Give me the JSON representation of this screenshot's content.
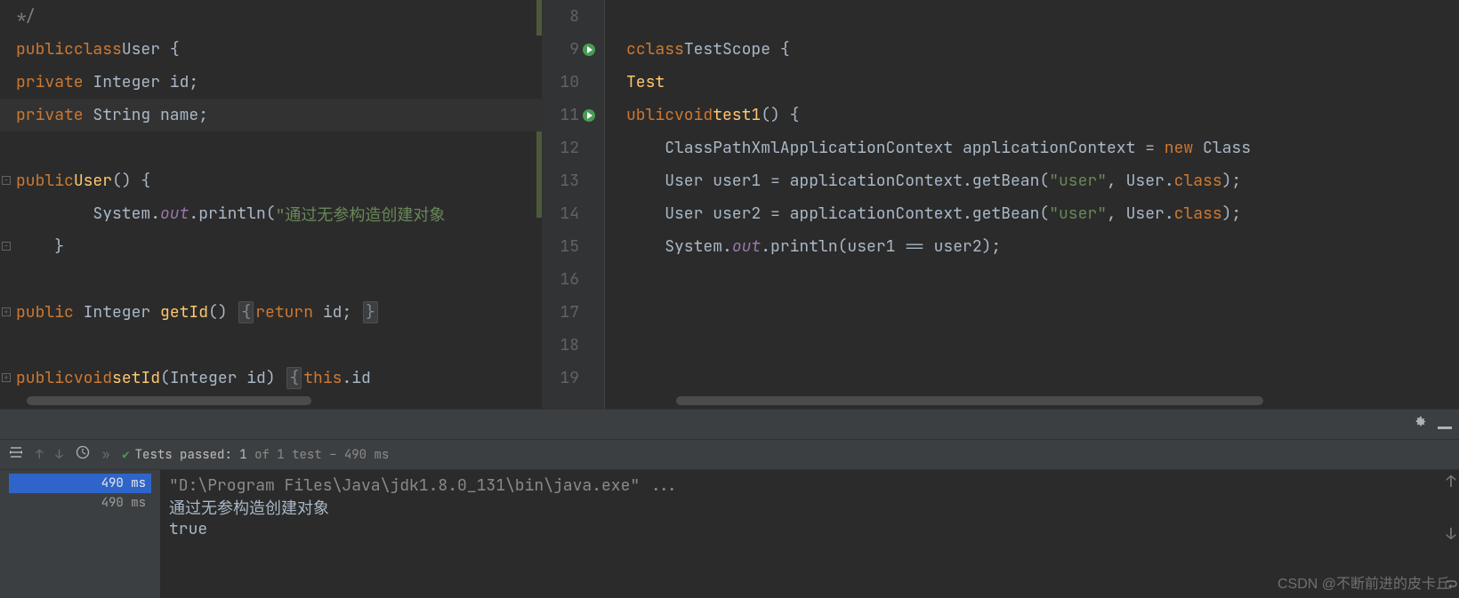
{
  "left": {
    "lines": [
      {
        "html": "<span class='comment'>*/</span>"
      },
      {
        "html": "<span class='kw'>public</span> <span class='kw'>class</span> <span class='classname'>User</span> {"
      },
      {
        "html": "    <span class='kw'>private</span> Integer id;"
      },
      {
        "html": "    <span class='kw'>private</span> String name;",
        "hl": true
      },
      {
        "html": "&nbsp;"
      },
      {
        "html": "    <span class='kw'>public</span> <span class='fn'>User</span>() {"
      },
      {
        "html": "        System.<span class='field-static'>out</span>.println(<span class='str'>\"通过无参构造创建对象</span>"
      },
      {
        "html": "    }"
      },
      {
        "html": "&nbsp;"
      },
      {
        "html": "    <span class='kw'>public</span> Integer <span class='fn'>getId</span>() <span class='fold-box'>{</span> <span class='kw'>return</span> id; <span class='fold-box'>}</span>"
      },
      {
        "html": "&nbsp;"
      },
      {
        "html": "    <span class='kw'>public</span> <span class='kw'>void</span> <span class='fn'>setId</span>(Integer id) <span class='fold-box'>{</span> <span class='this'>this</span>.id"
      }
    ],
    "folds": [
      {
        "row": 5,
        "sym": "−"
      },
      {
        "row": 7,
        "sym": "−"
      },
      {
        "row": 9,
        "sym": "+"
      },
      {
        "row": 11,
        "sym": "+"
      }
    ]
  },
  "right": {
    "gutter": [
      {
        "n": "8"
      },
      {
        "n": "9",
        "run": true
      },
      {
        "n": "10"
      },
      {
        "n": "11",
        "run": true
      },
      {
        "n": "12"
      },
      {
        "n": "13"
      },
      {
        "n": "14"
      },
      {
        "n": "15"
      },
      {
        "n": "16"
      },
      {
        "n": "17"
      },
      {
        "n": "18"
      },
      {
        "n": "19"
      }
    ],
    "lines": [
      {
        "html": "&nbsp;"
      },
      {
        "html": "<span class='kw'>c</span> <span class='kw'>class</span> <span class='classname'>TestScope</span> {"
      },
      {
        "html": "<span class='fn'>Test</span>"
      },
      {
        "html": "<span class='kw'>ublic</span> <span class='kw'>void</span> <span class='fn'>test1</span>() {"
      },
      {
        "html": "    ClassPathXmlApplicationContext applicationContext = <span class='kw'>new</span> Class"
      },
      {
        "html": "    User user1 = applicationContext.getBean(<span class='str'>\"user\"</span>, User.<span class='kw'>class</span>);"
      },
      {
        "html": "    User user2 = applicationContext.getBean(<span class='str'>\"user\"</span>, User.<span class='kw'>class</span>);"
      },
      {
        "html": "    System.<span class='field-static'>out</span>.println(user1 == user2);"
      },
      {
        "html": "&nbsp;",
        "foldend": true
      },
      {
        "html": "&nbsp;"
      },
      {
        "html": "&nbsp;"
      },
      {
        "html": "&nbsp;"
      }
    ]
  },
  "tool": {
    "tests_passed_prefix": "Tests passed:",
    "tests_passed_count": "1",
    "tests_passed_suffix": "of 1 test – 490 ms",
    "tree_time1": "490 ms",
    "tree_time2": "490 ms",
    "console_cmd": "\"D:\\Program Files\\Java\\jdk1.8.0_131\\bin\\java.exe\" ...",
    "console_line2": "通过无参构造创建对象",
    "console_line3": "true"
  },
  "watermark": "CSDN @不断前进的皮卡丘"
}
